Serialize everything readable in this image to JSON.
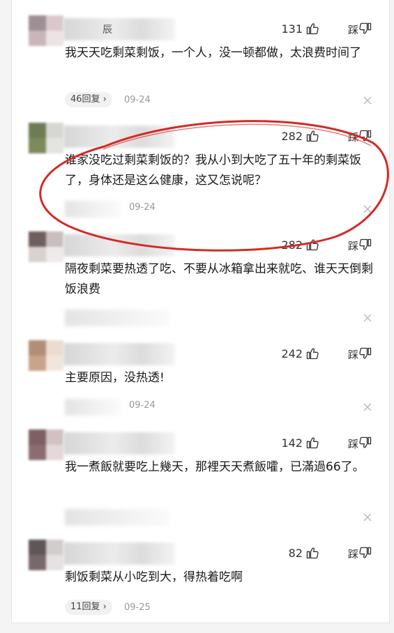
{
  "comments": [
    {
      "likes": "131",
      "dislike_label": "踩",
      "text": "我天天吃剩菜剩饭，一个人，没一顿都做，太浪费时间了",
      "replies_label": "46回复 ›",
      "date": "09-24",
      "username_glyph": "辰"
    },
    {
      "likes": "282",
      "dislike_label": "踩",
      "text": "谁家没吃过剩菜剩饭的？我从小到大吃了五十年的剩菜饭了，身体还是这么健康，这又怎说呢？",
      "replies_label": "",
      "date": "09-24"
    },
    {
      "likes": "282",
      "dislike_label": "踩",
      "text": "隔夜剩菜要热透了吃、不要从冰箱拿出来就吃、谁天天倒剩饭浪费",
      "replies_label": "",
      "date": ""
    },
    {
      "likes": "242",
      "dislike_label": "踩",
      "text": "主要原因，没热透!",
      "replies_label": "",
      "date": "09-24"
    },
    {
      "likes": "142",
      "dislike_label": "踩",
      "text": "我一煮飯就要吃上幾天，那裡天天煮飯嚯，已滿過66了。",
      "replies_label": "",
      "date": ""
    },
    {
      "likes": "82",
      "dislike_label": "踩",
      "text": "剩饭剩菜从小吃到大，得热着吃啊",
      "replies_label": "11回复 ›",
      "date": "09-25"
    }
  ],
  "colors": {
    "highlight_ellipse": "#d42a24",
    "text": "#1a1a1a",
    "meta": "#999999"
  },
  "icons": [
    "thumbs-up-icon",
    "thumbs-down-icon",
    "close-icon"
  ]
}
